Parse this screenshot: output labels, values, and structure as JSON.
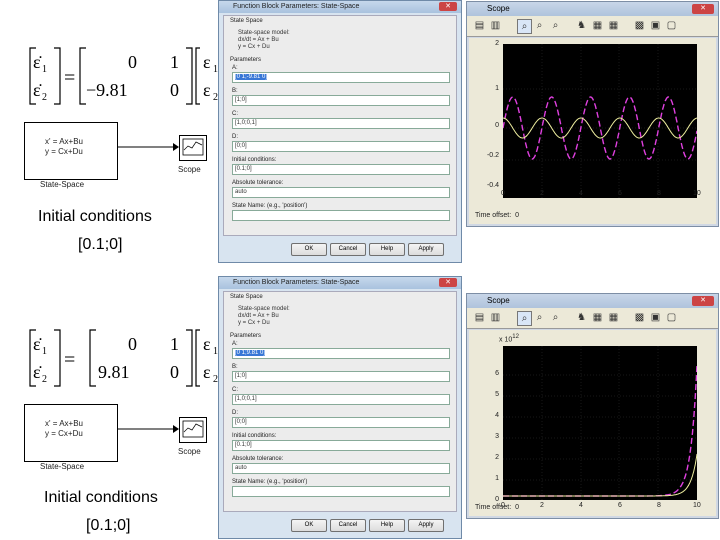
{
  "equation": {
    "state_vars": [
      "ε̇",
      "ε̇"
    ],
    "state_subs": [
      "1",
      "2"
    ],
    "rhs_vars": [
      "ε",
      "ε"
    ],
    "top": {
      "a11": "0",
      "a12": "1",
      "a21": "−9.81",
      "a22": "0"
    },
    "bottom": {
      "a11": "0",
      "a12": "1",
      "a21": "9.81",
      "a22": "0"
    }
  },
  "diagram": {
    "state_space_eq1": "x' = Ax+Bu",
    "state_space_eq2": "y = Cx+Du",
    "state_space_label": "State-Space",
    "scope_label": "Scope"
  },
  "ic_caption": {
    "title": "Initial conditions",
    "value": "[0.1;0]"
  },
  "dialog": {
    "title": "Function Block Parameters: State-Space",
    "group": "State Space",
    "description_1": "State-space model:",
    "description_2": "dx/dt = Ax + Bu",
    "description_3": "y = Cx + Du",
    "parameters_label": "Parameters",
    "fields": [
      {
        "label": "A:",
        "value": "[0 1;-9.81 0]"
      },
      {
        "label": "B:",
        "value": "[1;0]"
      },
      {
        "label": "C:",
        "value": "[1,0;0,1]"
      },
      {
        "label": "D:",
        "value": "[0;0]"
      },
      {
        "label": "Initial conditions:",
        "value": "[0.1;0]"
      },
      {
        "label": "Absolute tolerance:",
        "value": "auto"
      },
      {
        "label": "State Name: (e.g., 'position')",
        "value": ""
      }
    ],
    "fields_bottom_A": "[0 1;9.81 0]",
    "buttons": [
      "OK",
      "Cancel",
      "Help",
      "Apply"
    ]
  },
  "scope_top": {
    "title": "Scope",
    "yticks": [
      "2",
      "1",
      "0",
      "-0.2",
      "-0.4"
    ],
    "xticks": [
      "0",
      "2",
      "4",
      "6",
      "8",
      "10"
    ],
    "time_offset_label": "Time offset:",
    "time_offset_value": "0"
  },
  "scope_bottom": {
    "title": "Scope",
    "exponent": "x 10",
    "exponent_power": "12",
    "yticks": [
      "6",
      "5",
      "4",
      "3",
      "2",
      "1",
      "0"
    ],
    "xticks": [
      "0",
      "2",
      "4",
      "6",
      "8",
      "10"
    ],
    "time_offset_label": "Time offset:",
    "time_offset_value": "0"
  },
  "colors": {
    "plot_bg": "#000000",
    "trace_magenta": "#e040e0",
    "trace_yellow": "#f0f0a0",
    "selection": "#3877d6"
  }
}
